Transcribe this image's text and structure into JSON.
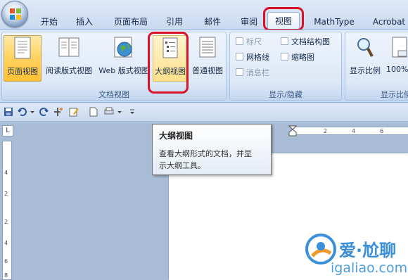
{
  "tabs": [
    "开始",
    "插入",
    "页面布局",
    "引用",
    "邮件",
    "审阅",
    "视图",
    "MathType",
    "Acrobat"
  ],
  "active_tab": "视图",
  "ribbon": {
    "doc_views": {
      "label": "文档视图",
      "buttons": [
        "页面视图",
        "阅读版式视图",
        "Web 版式视图",
        "大纲视图",
        "普通视图"
      ],
      "selected": "页面视图",
      "highlighted": "大纲视图"
    },
    "show_hide": {
      "label": "显示/隐藏",
      "items": [
        {
          "label": "标尺",
          "checked": false,
          "enabled": false
        },
        {
          "label": "文档结构图",
          "checked": false,
          "enabled": true
        },
        {
          "label": "网格线",
          "checked": false,
          "enabled": true
        },
        {
          "label": "缩略图",
          "checked": false,
          "enabled": true
        },
        {
          "label": "消息栏",
          "checked": false,
          "enabled": false
        }
      ]
    },
    "zoom": {
      "label": "显示比例",
      "buttons": [
        "显示比例",
        "100%"
      ]
    }
  },
  "tooltip": {
    "title": "大纲视图",
    "body_line1": "查看大纲形式的文档，并显",
    "body_line2": "示大纲工具。"
  },
  "ruler": {
    "corner_mark": "L",
    "horizontal_labels": [
      "2",
      "4",
      "6"
    ],
    "vertical_labels": [
      "4",
      "2",
      "2",
      "4",
      "6",
      "8"
    ]
  },
  "watermark": {
    "chinese": "爱·尬聊",
    "domain": "igaliao.com"
  },
  "colors": {
    "highlight_ring": "#d9122a",
    "selected_button": "#ffd25e",
    "ribbon_blue": "#d7e4f5"
  }
}
